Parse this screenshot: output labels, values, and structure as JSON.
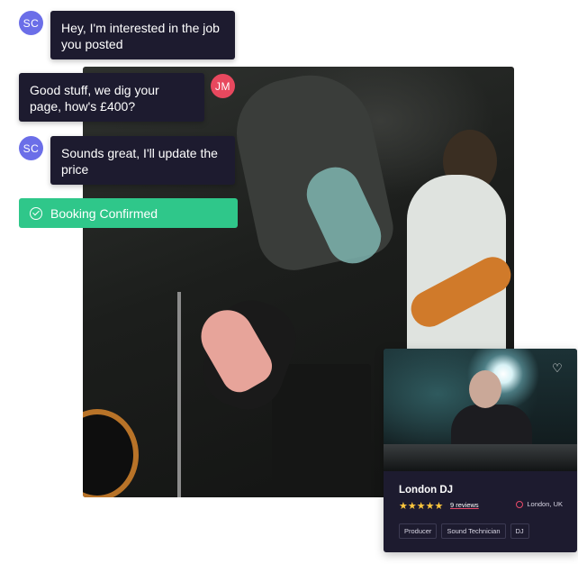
{
  "colors": {
    "bubble": "#1d1b2f",
    "avatar_sc": "#6b6ee8",
    "avatar_jm": "#e8485e",
    "confirm": "#2fc78a",
    "stars": "#ffc83d"
  },
  "chat": {
    "messages": [
      {
        "initials": "SC",
        "text": "Hey, I'm interested in the job you posted"
      },
      {
        "initials": "JM",
        "text": "Good stuff, we dig your page, how's £400?"
      },
      {
        "initials": "SC",
        "text": "Sounds great, I'll update the price"
      }
    ],
    "confirmation": "Booking Confirmed",
    "confirmation_icon": "check-circle-icon"
  },
  "card": {
    "title": "London DJ",
    "rating": 5,
    "stars": "★★★★★",
    "reviews": "9 reviews",
    "location": "London, UK",
    "location_icon": "map-pin-icon",
    "favorite_icon": "heart-icon",
    "tags": [
      "Producer",
      "Sound Technician",
      "DJ"
    ]
  }
}
